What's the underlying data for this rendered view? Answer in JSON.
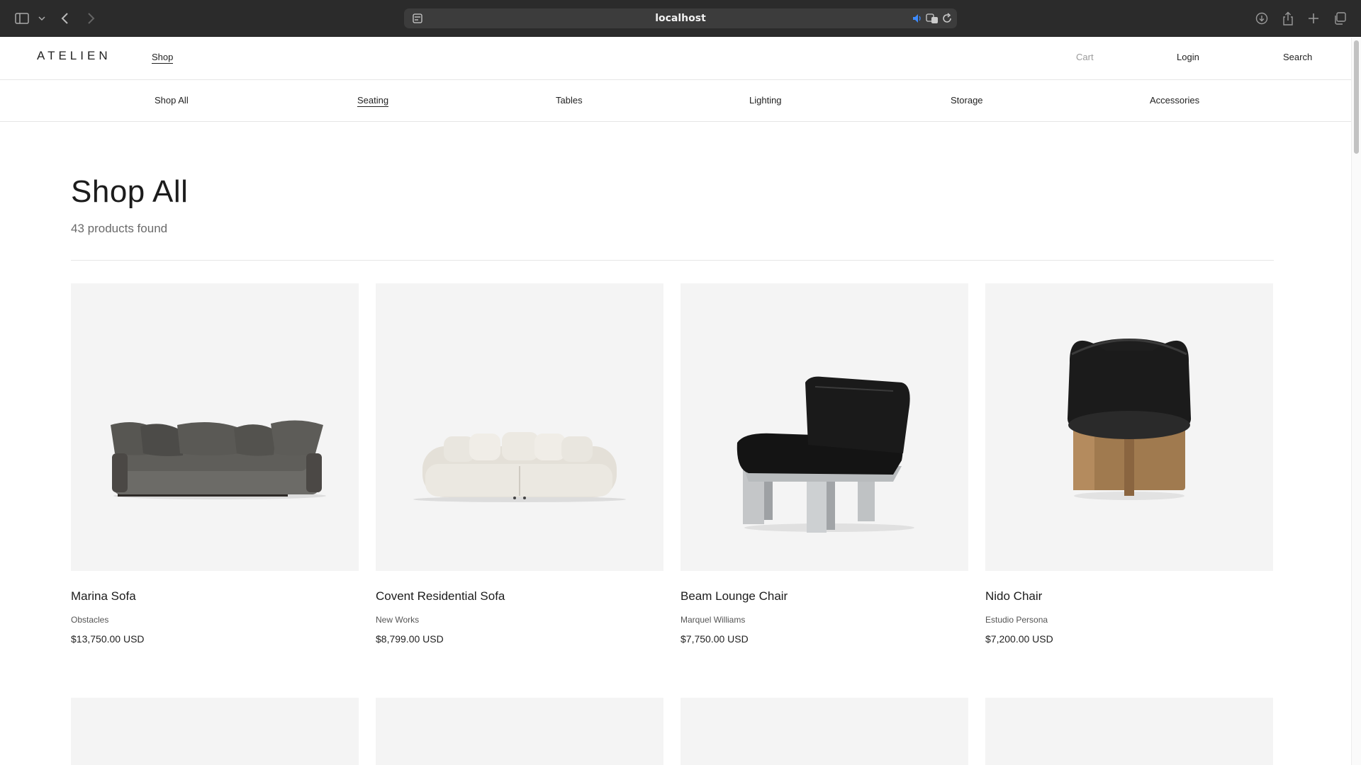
{
  "browser": {
    "url": "localhost",
    "icons": [
      "sidebar-icon",
      "chevron-down-icon",
      "back-icon",
      "forward-icon",
      "site-settings-icon",
      "audio-icon",
      "translate-icon",
      "reload-icon",
      "download-icon",
      "share-icon",
      "new-tab-icon",
      "tabs-overview-icon"
    ]
  },
  "header": {
    "logo": "ATELIEN",
    "shop_label": "Shop",
    "cart_label": "Cart",
    "login_label": "Login",
    "search_label": "Search"
  },
  "categories": [
    {
      "label": "Shop All",
      "active": false
    },
    {
      "label": "Seating",
      "active": true
    },
    {
      "label": "Tables",
      "active": false
    },
    {
      "label": "Lighting",
      "active": false
    },
    {
      "label": "Storage",
      "active": false
    },
    {
      "label": "Accessories",
      "active": false
    }
  ],
  "main": {
    "title": "Shop All",
    "count_text": "43 products found"
  },
  "products": [
    {
      "name": "Marina Sofa",
      "maker": "Obstacles",
      "price": "$13,750.00 USD",
      "image": "grey-sofa-image"
    },
    {
      "name": "Covent Residential Sofa",
      "maker": "New Works",
      "price": "$8,799.00 USD",
      "image": "cream-sofa-image"
    },
    {
      "name": "Beam Lounge Chair",
      "maker": "Marquel Williams",
      "price": "$7,750.00 USD",
      "image": "black-leather-lounge-chair-image"
    },
    {
      "name": "Nido Chair",
      "maker": "Estudio Persona",
      "price": "$7,200.00 USD",
      "image": "round-leather-chair-image"
    }
  ],
  "colors": {
    "chrome_bg": "#2b2b2b",
    "card_bg": "#f4f4f4",
    "text": "#1c1c1c",
    "muted": "#9a9a9a"
  }
}
